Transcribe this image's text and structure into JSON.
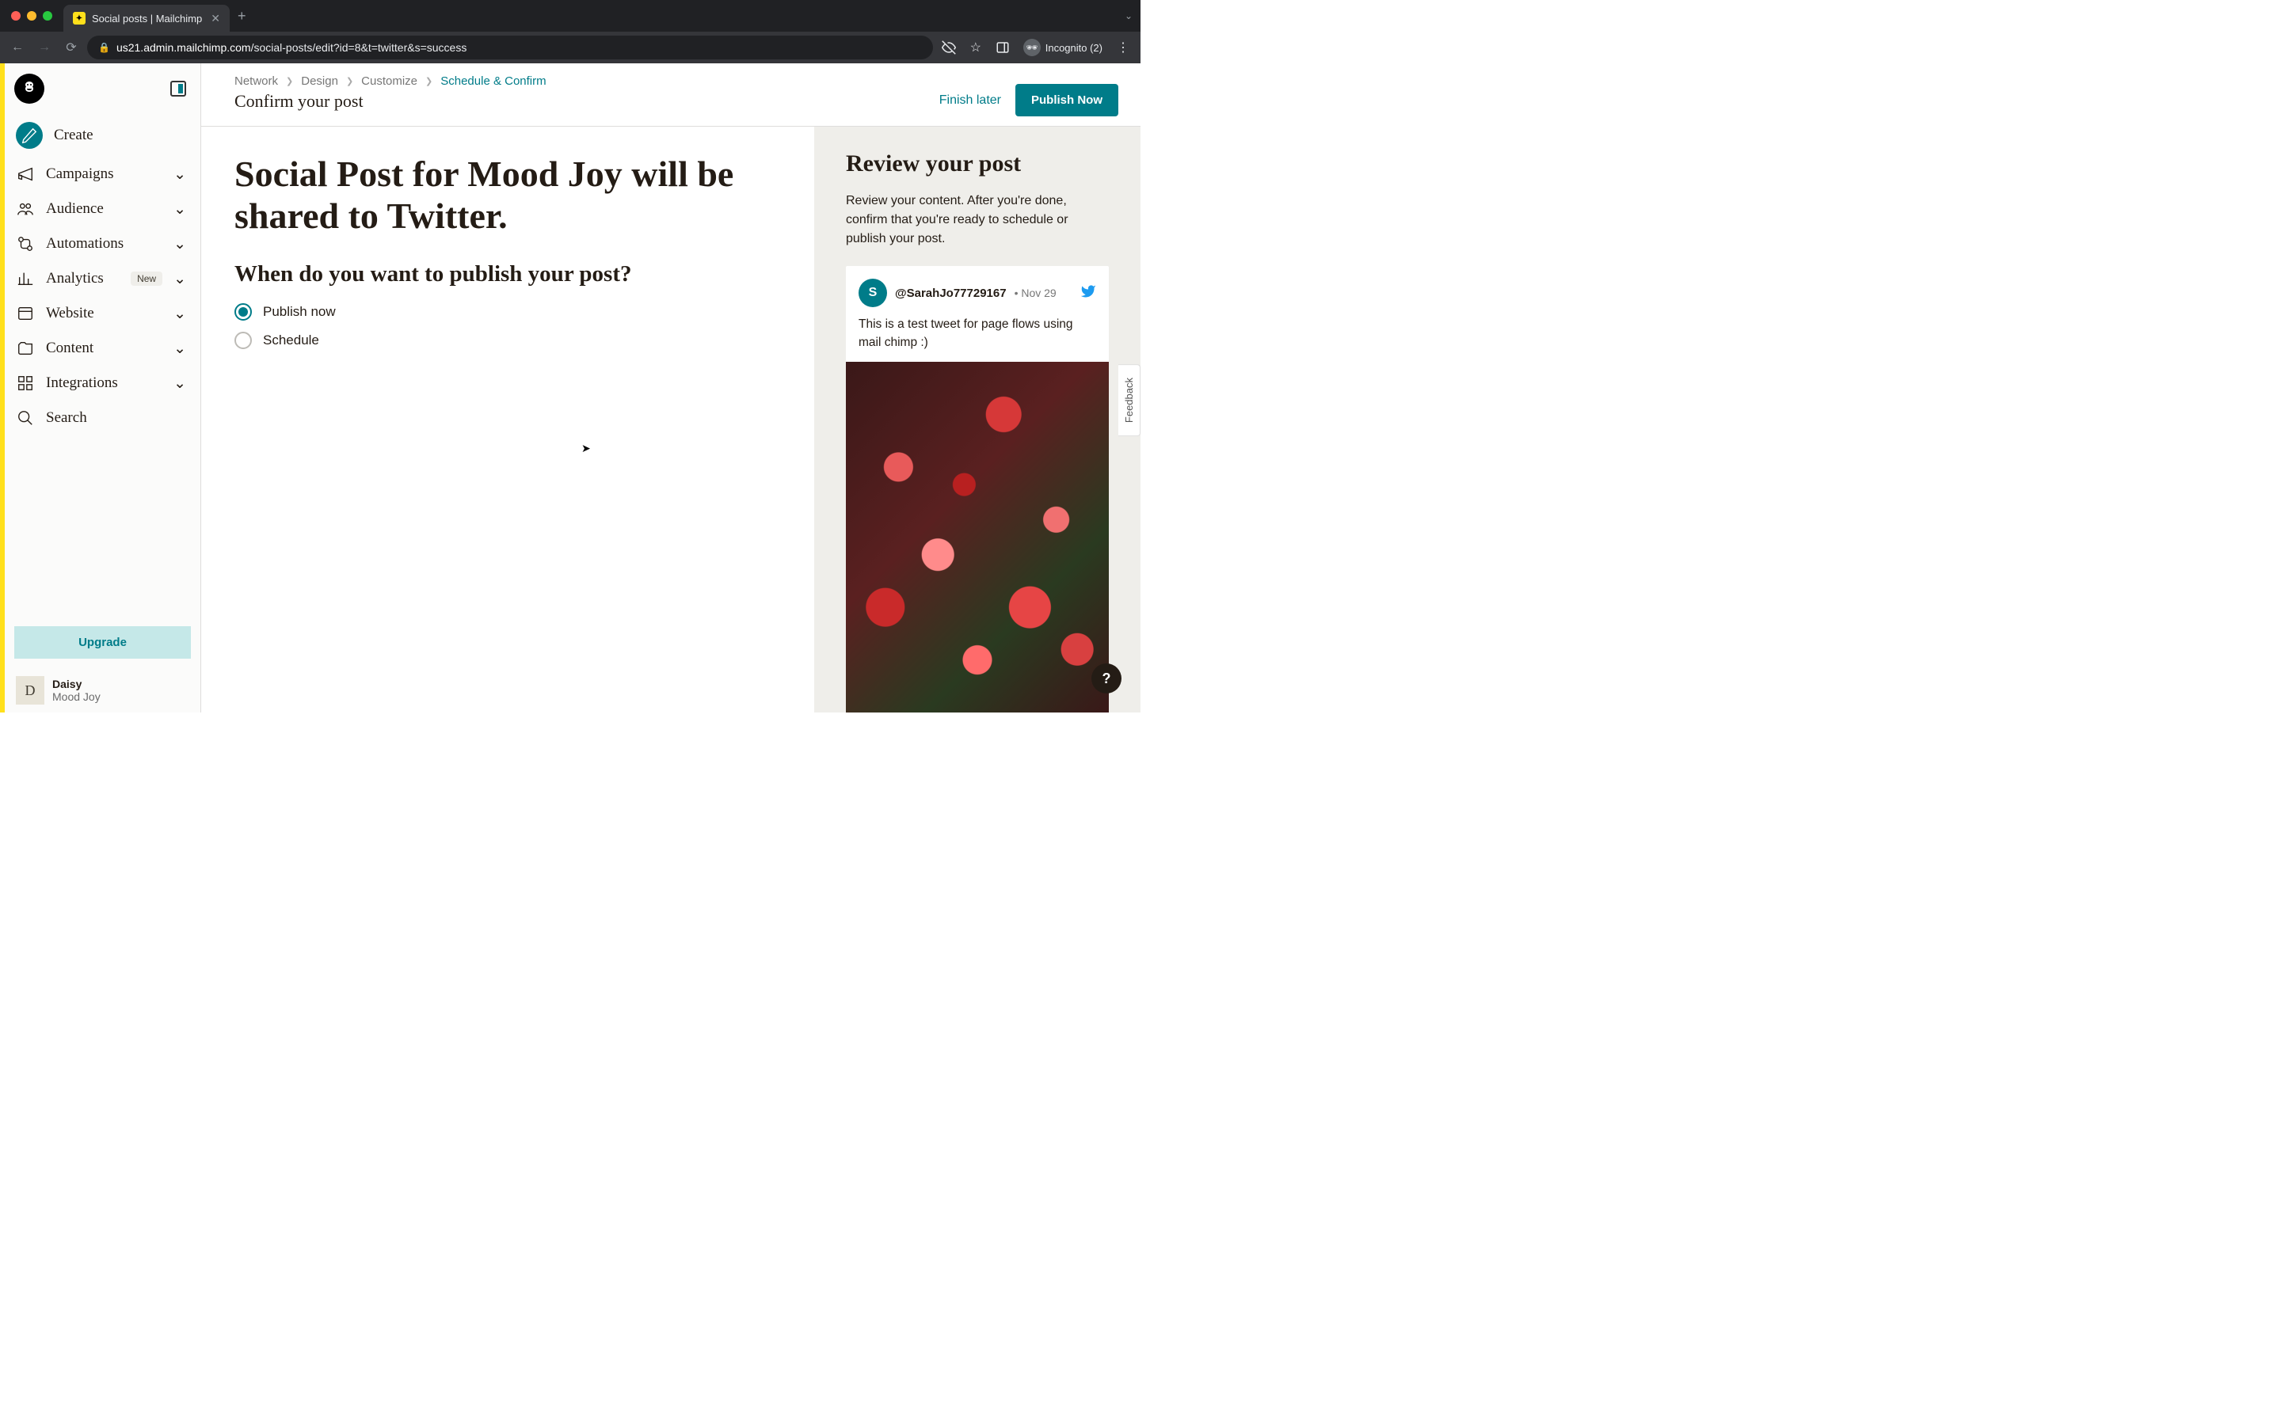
{
  "browser": {
    "tab_title": "Social posts | Mailchimp",
    "url_host": "us21.admin.mailchimp.com",
    "url_path": "/social-posts/edit?id=8&t=twitter&s=success",
    "incognito_label": "Incognito (2)"
  },
  "sidebar": {
    "create": "Create",
    "items": [
      {
        "label": "Campaigns"
      },
      {
        "label": "Audience"
      },
      {
        "label": "Automations"
      },
      {
        "label": "Analytics",
        "badge": "New"
      },
      {
        "label": "Website"
      },
      {
        "label": "Content"
      },
      {
        "label": "Integrations"
      }
    ],
    "search": "Search",
    "upgrade": "Upgrade",
    "user": {
      "initial": "D",
      "name": "Daisy",
      "org": "Mood Joy"
    }
  },
  "breadcrumbs": [
    "Network",
    "Design",
    "Customize",
    "Schedule & Confirm"
  ],
  "page_title": "Confirm your post",
  "actions": {
    "finish_later": "Finish later",
    "publish": "Publish Now"
  },
  "main": {
    "headline": "Social Post for Mood Joy will be shared to Twitter.",
    "subhead": "When do you want to publish your post?",
    "options": {
      "publish_now": "Publish now",
      "schedule": "Schedule"
    }
  },
  "review": {
    "title": "Review your post",
    "desc": "Review your content. After you're done, confirm that you're ready to schedule or publish your post.",
    "tweet": {
      "avatar_initial": "S",
      "handle": "@SarahJo77729167",
      "date": "Nov 29",
      "text": "This is a test tweet for page flows using mail chimp :)"
    }
  },
  "misc": {
    "feedback": "Feedback",
    "help": "?"
  }
}
